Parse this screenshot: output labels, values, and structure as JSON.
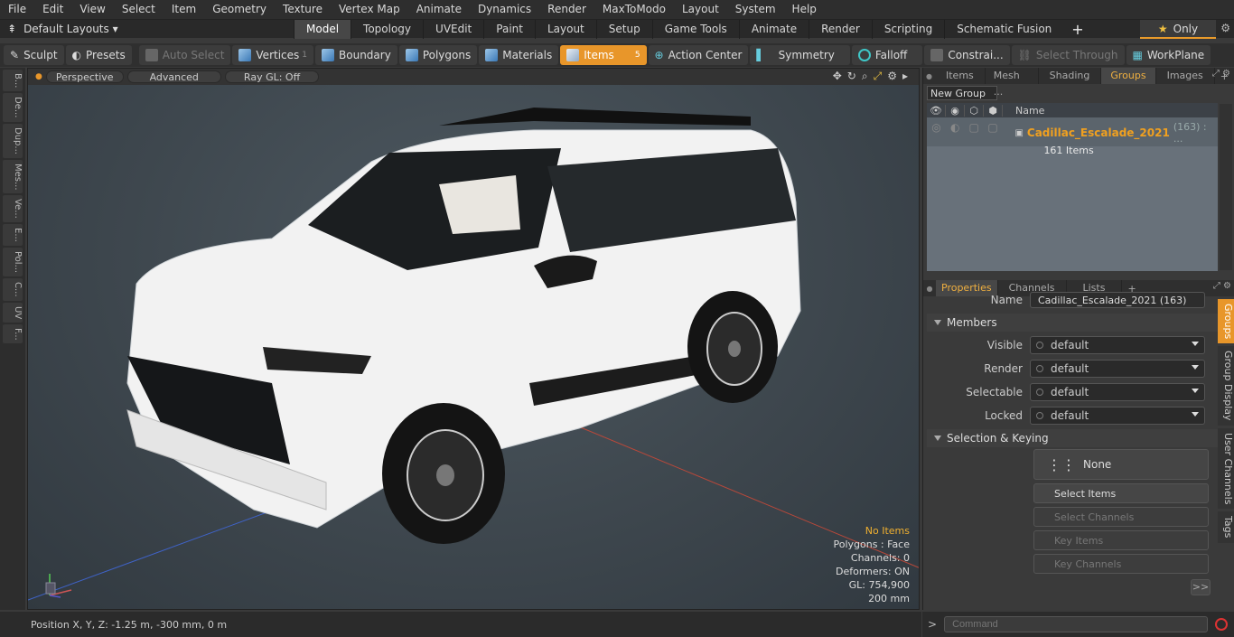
{
  "menu": [
    "File",
    "Edit",
    "View",
    "Select",
    "Item",
    "Geometry",
    "Texture",
    "Vertex Map",
    "Animate",
    "Dynamics",
    "Render",
    "MaxToModo",
    "Layout",
    "System",
    "Help"
  ],
  "layouts_label": "Default Layouts ▾",
  "mode_tabs": [
    "Model",
    "Topology",
    "UVEdit",
    "Paint",
    "Layout",
    "Setup",
    "Game Tools",
    "Animate",
    "Render",
    "Scripting",
    "Schematic Fusion"
  ],
  "only_label": "Only",
  "toolbar": {
    "sculpt": "Sculpt",
    "presets": "Presets",
    "auto_select": "Auto Select",
    "vertices": "Vertices",
    "vertices_count": "1",
    "boundary": "Boundary",
    "polygons": "Polygons",
    "materials": "Materials",
    "items": "Items",
    "items_count": "5",
    "action_center": "Action Center",
    "symmetry": "Symmetry",
    "falloff": "Falloff",
    "constraints": "Constrai...",
    "select_through": "Select Through",
    "workplane": "WorkPlane"
  },
  "left_tabs": [
    "B...",
    "De...",
    "Dup...",
    "Mes...",
    "Ve...",
    "E...",
    "Pol...",
    "C...",
    "UV",
    "F..."
  ],
  "viewport": {
    "perspective": "Perspective",
    "advanced": "Advanced",
    "raygl": "Ray GL: Off"
  },
  "stats": {
    "no_items": "No Items",
    "polygons": "Polygons : Face",
    "channels": "Channels: 0",
    "deformers": "Deformers: ON",
    "gl": "GL: 754,900",
    "scale": "200 mm"
  },
  "status": {
    "position": "Position X, Y, Z:   -1.25 m, -300 mm, 0 m"
  },
  "top_tabs": [
    "Items",
    "Mesh ...",
    "Shading",
    "Groups",
    "Images"
  ],
  "new_group": "New Group",
  "group_table": {
    "name_col": "Name",
    "group_name": "Cadillac_Escalade_2021",
    "group_count": "(163) : ...",
    "group_items": "161 Items"
  },
  "prop_tabs": [
    "Properties",
    "Channels",
    "Lists"
  ],
  "properties": {
    "name_label": "Name",
    "name_value": "Cadillac_Escalade_2021 (163)",
    "members": "Members",
    "visible_label": "Visible",
    "render_label": "Render",
    "selectable_label": "Selectable",
    "locked_label": "Locked",
    "default_value": "default",
    "selection_keying": "Selection & Keying",
    "none": "None",
    "select_items": "Select Items",
    "select_channels": "Select Channels",
    "key_items": "Key Items",
    "key_channels": "Key Channels",
    "more": ">>"
  },
  "vertical_tabs": [
    "Groups",
    "Group Display",
    "User Channels",
    "Tags"
  ],
  "command_placeholder": "Command",
  "colors": {
    "accent": "#e8962a",
    "group_name": "#f0a020"
  }
}
